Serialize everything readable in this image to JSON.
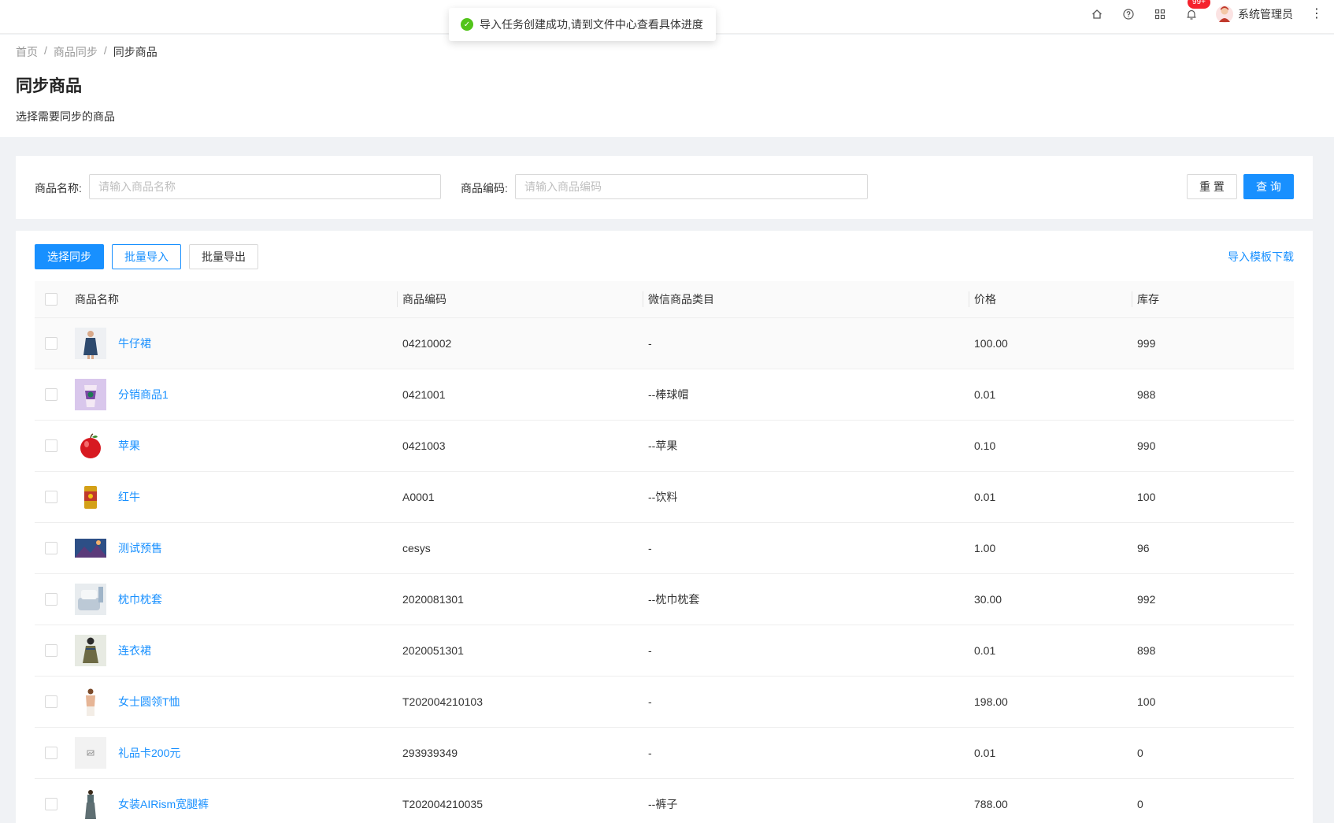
{
  "topbar": {
    "badge": "99+",
    "username": "系统管理员"
  },
  "toast": {
    "message": "导入任务创建成功,请到文件中心查看具体进度"
  },
  "breadcrumb": [
    "首页",
    "商品同步",
    "同步商品"
  ],
  "page": {
    "title": "同步商品",
    "description": "选择需要同步的商品"
  },
  "filter": {
    "name_label": "商品名称:",
    "name_placeholder": "请输入商品名称",
    "name_value": "",
    "code_label": "商品编码:",
    "code_placeholder": "请输入商品编码",
    "code_value": "",
    "reset_label": "重 置",
    "query_label": "查 询"
  },
  "toolbar": {
    "sync_label": "选择同步",
    "import_label": "批量导入",
    "export_label": "批量导出",
    "template_link": "导入模板下载"
  },
  "table": {
    "columns": [
      "商品名称",
      "商品编码",
      "微信商品类目",
      "价格",
      "库存"
    ],
    "rows": [
      {
        "name": "牛仔裙",
        "code": "04210002",
        "category": "-",
        "price": "100.00",
        "stock": "999",
        "thumb": "dress"
      },
      {
        "name": "分销商品1",
        "code": "0421001",
        "category": "--棒球帽",
        "price": "0.01",
        "stock": "988",
        "thumb": "drink"
      },
      {
        "name": "苹果",
        "code": "0421003",
        "category": "--苹果",
        "price": "0.10",
        "stock": "990",
        "thumb": "apple"
      },
      {
        "name": "红牛",
        "code": "A0001",
        "category": "--饮料",
        "price": "0.01",
        "stock": "100",
        "thumb": "can"
      },
      {
        "name": "测试预售",
        "code": "cesys",
        "category": "-",
        "price": "1.00",
        "stock": "96",
        "thumb": "landscape"
      },
      {
        "name": "枕巾枕套",
        "code": "2020081301",
        "category": "--枕巾枕套",
        "price": "30.00",
        "stock": "992",
        "thumb": "pillow"
      },
      {
        "name": "连衣裙",
        "code": "2020051301",
        "category": "-",
        "price": "0.01",
        "stock": "898",
        "thumb": "dress2"
      },
      {
        "name": "女士圆领T恤",
        "code": "T202004210103",
        "category": "-",
        "price": "198.00",
        "stock": "100",
        "thumb": "tshirt"
      },
      {
        "name": "礼品卡200元",
        "code": "293939349",
        "category": "-",
        "price": "0.01",
        "stock": "0",
        "thumb": "placeholder"
      },
      {
        "name": "女装AIRism宽腿裤",
        "code": "T202004210035",
        "category": "--裤子",
        "price": "788.00",
        "stock": "0",
        "thumb": "pants"
      }
    ]
  },
  "colors": {
    "primary": "#1890ff",
    "success": "#52c41a",
    "danger": "#f5222d"
  }
}
